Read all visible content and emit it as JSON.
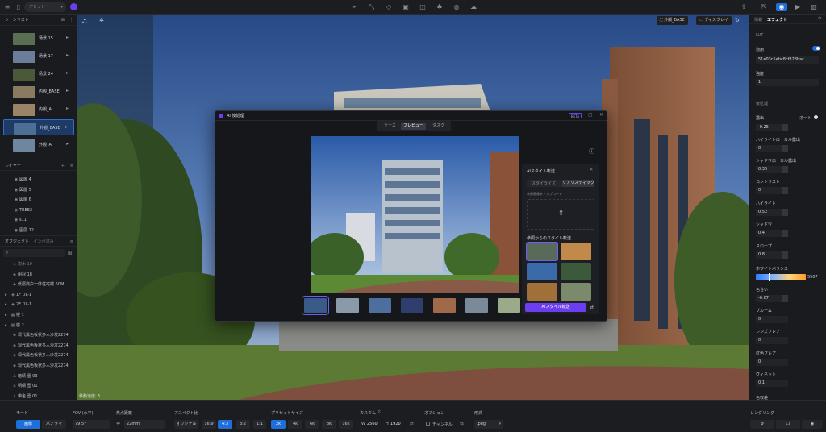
{
  "topbar": {
    "asset_label": "アセット",
    "icons": [
      "menu-icon",
      "file-icon",
      "pin-icon",
      "path-icon",
      "shape-icon",
      "cube-icon",
      "camera-plus-icon",
      "tree-icon",
      "car-icon",
      "cloud-icon",
      "share-icon",
      "export-icon",
      "camera-icon",
      "video-icon",
      "image-icon"
    ]
  },
  "scene_list": {
    "title": "シーンリスト",
    "items": [
      {
        "label": "场景 15",
        "thumb": "#5a6e52"
      },
      {
        "label": "场景 17",
        "thumb": "#6a7e9a"
      },
      {
        "label": "场景 24",
        "thumb": "#4a5a38"
      },
      {
        "label": "内観_BASE",
        "thumb": "#8a7a60"
      },
      {
        "label": "内観_AI",
        "thumb": "#9a8468"
      },
      {
        "label": "外観_BASE",
        "thumb": "#4d6e96"
      },
      {
        "label": "外観_AI",
        "thumb": "#6e86a0"
      }
    ]
  },
  "layers": {
    "title": "レイヤー",
    "items": [
      "図層 4",
      "図層 5",
      "図層 6",
      "TREE2",
      "s11",
      "图层 12"
    ]
  },
  "objects": {
    "tab_objects": "オブジェクト",
    "tab_imported": "インポ済み",
    "search_placeholder": "",
    "items": [
      {
        "label": "樹木 10",
        "icon": "stack-icon",
        "caret": false
      },
      {
        "label": "树冠 18",
        "icon": "stack-icon",
        "caret": false
      },
      {
        "label": "低层商户一体住宅楼 60M",
        "icon": "stack-icon",
        "caret": false
      },
      {
        "label": "1F DL-1",
        "icon": "stack-icon",
        "caret": true
      },
      {
        "label": "2F DL-1",
        "icon": "stack-icon",
        "caret": true
      },
      {
        "label": "楼 1",
        "icon": "grid-icon",
        "caret": true
      },
      {
        "label": "楼 2",
        "icon": "grid-icon",
        "caret": true
      },
      {
        "label": "现代黑色板状多人沙发2274",
        "icon": "stack-icon",
        "caret": false
      },
      {
        "label": "现代黑色板状多人沙发2274",
        "icon": "stack-icon",
        "caret": false
      },
      {
        "label": "现代黑色板状多人沙发2274",
        "icon": "stack-icon",
        "caret": false
      },
      {
        "label": "现代黑色板状多人沙发2274",
        "icon": "stack-icon",
        "caret": false
      },
      {
        "label": "暗晴 壹 03",
        "icon": "person-icon",
        "caret": false
      },
      {
        "label": "明晴 壹 01",
        "icon": "person-icon",
        "caret": false
      },
      {
        "label": "带金 壹 01",
        "icon": "person-icon",
        "caret": false
      }
    ]
  },
  "viewport": {
    "move_speed_label": "移動速度: 5",
    "camera_label": "外観_BASE",
    "display_label": "ディスプレイ"
  },
  "modal": {
    "title": "AI 後処理",
    "beta": "BETA",
    "tabs": [
      {
        "label": "ソース",
        "active": false
      },
      {
        "label": "プレビュー",
        "active": true
      },
      {
        "label": "タスク",
        "active": false
      }
    ],
    "style_panel": {
      "title": "AIスタイル転送",
      "tab_stylize": "スタイライズ",
      "tab_realistic": "リアリスティック",
      "upload_label": "参照画像をアップロード",
      "ref_styles_label": "参照からのスタイル転送",
      "apply_button": "AIスタイル転送"
    },
    "thumbnails": [
      "#3a5a8a",
      "#8a9aa8",
      "#4e6e9e",
      "#2e3e6e",
      "#a06a4a",
      "#7a8a9a",
      "#9aaa8a"
    ]
  },
  "right_panel": {
    "tab_info": "情報",
    "tab_effects": "エフェクト",
    "lut_section": "LUT",
    "apply_label": "適用",
    "lut_file": "51e03c5ebc8cf828bac...",
    "strength_label": "強度",
    "strength_value": "1",
    "post_section": "後処理",
    "exposure_label": "露出",
    "exposure_auto": "オート",
    "exposure_value": "-0.25",
    "highlight_local_label": "ハイライトローカル露出",
    "highlight_local_value": "0",
    "shadow_local_label": "シャドウローカル露出",
    "shadow_local_value": "0.35",
    "contrast_label": "コントラスト",
    "contrast_value": "0",
    "highlight_label": "ハイライト",
    "highlight_value": "0.52",
    "shadow_label": "シャドウ",
    "shadow_value": "0.4",
    "slope_label": "スロープ",
    "slope_value": "0.8",
    "wb_label": "ホワイトバランス",
    "wb_value": "5507",
    "tint_label": "色合い",
    "tint_value": "-0.07",
    "bloom_label": "ブルーム",
    "bloom_value": "0",
    "lens_flare_label": "レンズフレア",
    "lens_flare_value": "0",
    "rainbow_flare_label": "虹色フレア",
    "rainbow_flare_value": "0",
    "vignette_label": "ヴィネット",
    "vignette_value": "0.1",
    "chroma_label": "色収差"
  },
  "bottombar": {
    "mode_label": "モード",
    "mode_photo": "画像",
    "mode_pano": "パノラマ",
    "fov_label": "FOV (水平)",
    "fov_value": "79.5°",
    "focal_label": "焦点距離",
    "focal_value": "22mm",
    "aspect_label": "アスペクト比",
    "aspect_options": [
      "オリジナル",
      "16:9",
      "4:3",
      "3:2",
      "1:1"
    ],
    "preset_label": "プリセットサイズ",
    "preset_options": [
      "2k",
      "4k",
      "6k",
      "8k",
      "16k"
    ],
    "custom_label": "カスタム",
    "width_label": "W",
    "width_value": "2560",
    "height_label": "H",
    "height_value": "1920",
    "options_label": "オプション",
    "channel_label": "チャンネル",
    "format_label": "形式",
    "format_value": ".png",
    "render_label": "レンダリング"
  },
  "colors": {
    "accent": "#1e6fd9",
    "purple": "#6b3ff0"
  }
}
